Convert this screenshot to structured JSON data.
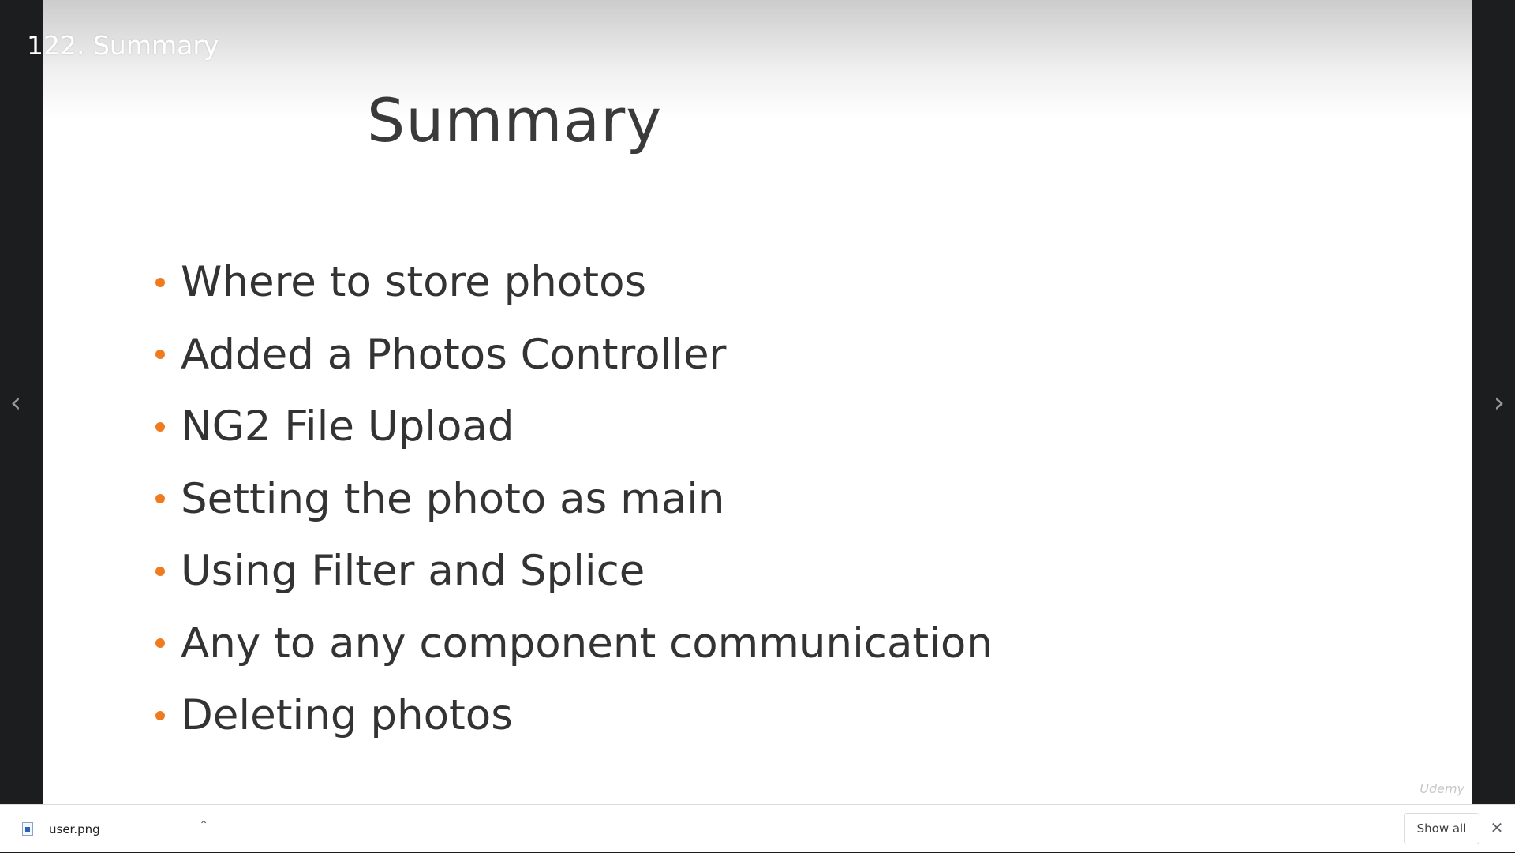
{
  "player": {
    "lecture_title": "122. Summary",
    "prev_icon": "chevron-left-icon",
    "next_icon": "chevron-right-icon",
    "prev_glyph": "‹",
    "next_glyph": "›",
    "watermark": "Udemy"
  },
  "slide": {
    "heading": "Summary",
    "bullets": [
      "Where to store photos",
      "Added a Photos Controller",
      "NG2 File Upload",
      "Setting the photo as main",
      "Using Filter and Splice",
      "Any to any component communication",
      "Deleting photos"
    ],
    "bullet_color": "#f07a1e",
    "text_color": "#333333"
  },
  "download_bar": {
    "file_name": "user.png",
    "file_icon": "image-file-icon",
    "chevron_icon": "chevron-up-icon",
    "chevron_glyph": "⌃",
    "show_all_label": "Show all",
    "close_icon": "close-icon",
    "close_glyph": "✕"
  }
}
